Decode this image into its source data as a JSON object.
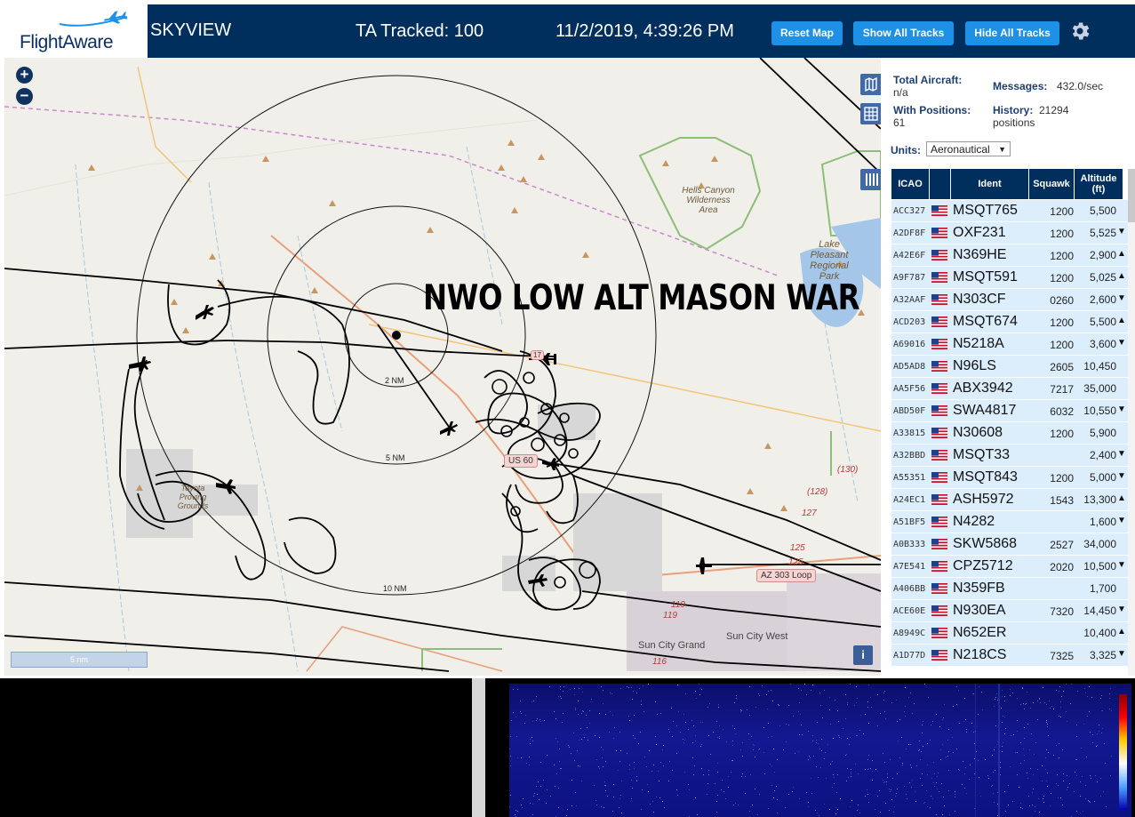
{
  "header": {
    "logo_text": "FlightAware",
    "app_name": "SKYVIEW",
    "ta_tracked": "TA Tracked: 100",
    "datetime": "11/2/2019, 4:39:26 PM",
    "buttons": {
      "reset_map": "Reset Map",
      "show_all_tracks": "Show All Tracks",
      "hide_all_tracks": "Hide All Tracks"
    },
    "settings_icon": "gear-icon"
  },
  "map": {
    "overlay_title": "NWO LOW ALT MASON WAR",
    "zoom_in": "+",
    "zoom_out": "−",
    "scalebar": "5 nm",
    "info": "i",
    "range_rings": [
      "2 NM",
      "5 NM",
      "10 NM"
    ],
    "labels": {
      "hells_canyon": "Hells Canyon Wilderness Area",
      "lake_pleasant": "Lake Pleasant Regional Park",
      "toyota": "Toyota Proving Grounds",
      "sun_city_grand": "Sun City Grand",
      "sun_city_west": "Sun City West"
    },
    "shields": {
      "us60": "US 60",
      "az303": "AZ 303 Loop",
      "wp": "17"
    },
    "road_numbers": [
      "(130)",
      "(128)",
      "127",
      "125",
      "125",
      "119",
      "119",
      "116"
    ],
    "controls": [
      "map-layers-icon",
      "grid-icon",
      "columns-icon"
    ],
    "colors": {
      "background": "#f1efe9",
      "tracks": "#000000",
      "road_major": "#e8a07a",
      "boundary": "#6fae5a",
      "water": "#a4c6e8"
    }
  },
  "panel": {
    "total_aircraft_label": "Total Aircraft:",
    "total_aircraft_value": "n/a",
    "with_positions_label": "With Positions:",
    "with_positions_value": "61",
    "messages_label": "Messages:",
    "messages_value": "432.0/sec",
    "history_label": "History:",
    "history_value": "21294",
    "history_unit": "positions",
    "units_label": "Units:",
    "units_value": "Aeronautical",
    "columns": [
      "ICAO",
      "",
      "Ident",
      "Squawk",
      "Altitude (ft)"
    ],
    "rows": [
      {
        "icao": "ACC327",
        "ident": "MSQT765",
        "squawk": "1200",
        "altitude": "5,500",
        "trend": ""
      },
      {
        "icao": "A2DF8F",
        "ident": "OXF231",
        "squawk": "1200",
        "altitude": "5,525",
        "trend": "▼"
      },
      {
        "icao": "A42E6F",
        "ident": "N369HE",
        "squawk": "1200",
        "altitude": "2,900",
        "trend": "▲"
      },
      {
        "icao": "A9F787",
        "ident": "MSQT591",
        "squawk": "1200",
        "altitude": "5,025",
        "trend": "▲"
      },
      {
        "icao": "A32AAF",
        "ident": "N303CF",
        "squawk": "0260",
        "altitude": "2,600",
        "trend": "▼"
      },
      {
        "icao": "ACD203",
        "ident": "MSQT674",
        "squawk": "1200",
        "altitude": "5,500",
        "trend": "▲"
      },
      {
        "icao": "A69016",
        "ident": "N5218A",
        "squawk": "1200",
        "altitude": "3,600",
        "trend": "▼"
      },
      {
        "icao": "AD5AD8",
        "ident": "N96LS",
        "squawk": "2605",
        "altitude": "10,450",
        "trend": ""
      },
      {
        "icao": "AA5F56",
        "ident": "ABX3942",
        "squawk": "7217",
        "altitude": "35,000",
        "trend": ""
      },
      {
        "icao": "ABD50F",
        "ident": "SWA4817",
        "squawk": "6032",
        "altitude": "10,550",
        "trend": "▼"
      },
      {
        "icao": "A33815",
        "ident": "N30608",
        "squawk": "1200",
        "altitude": "5,900",
        "trend": ""
      },
      {
        "icao": "A32BBD",
        "ident": "MSQT33",
        "squawk": "",
        "altitude": "2,400",
        "trend": "▼"
      },
      {
        "icao": "A55351",
        "ident": "MSQT843",
        "squawk": "1200",
        "altitude": "5,000",
        "trend": "▼"
      },
      {
        "icao": "A24EC1",
        "ident": "ASH5972",
        "squawk": "1543",
        "altitude": "13,300",
        "trend": "▲"
      },
      {
        "icao": "A51BF5",
        "ident": "N4282",
        "squawk": "",
        "altitude": "1,600",
        "trend": "▼"
      },
      {
        "icao": "A0B333",
        "ident": "SKW5868",
        "squawk": "2527",
        "altitude": "34,000",
        "trend": ""
      },
      {
        "icao": "A7E541",
        "ident": "CPZ5712",
        "squawk": "2020",
        "altitude": "10,500",
        "trend": "▼"
      },
      {
        "icao": "A406BB",
        "ident": "N359FB",
        "squawk": "",
        "altitude": "1,700",
        "trend": ""
      },
      {
        "icao": "ACE60E",
        "ident": "N930EA",
        "squawk": "7320",
        "altitude": "14,450",
        "trend": "▼"
      },
      {
        "icao": "A8949C",
        "ident": "N652ER",
        "squawk": "",
        "altitude": "10,400",
        "trend": "▲"
      },
      {
        "icao": "A1D77D",
        "ident": "N218CS",
        "squawk": "7325",
        "altitude": "3,325",
        "trend": "▼"
      }
    ],
    "header_color": "#002f5d",
    "row_color": "#dceefc"
  }
}
